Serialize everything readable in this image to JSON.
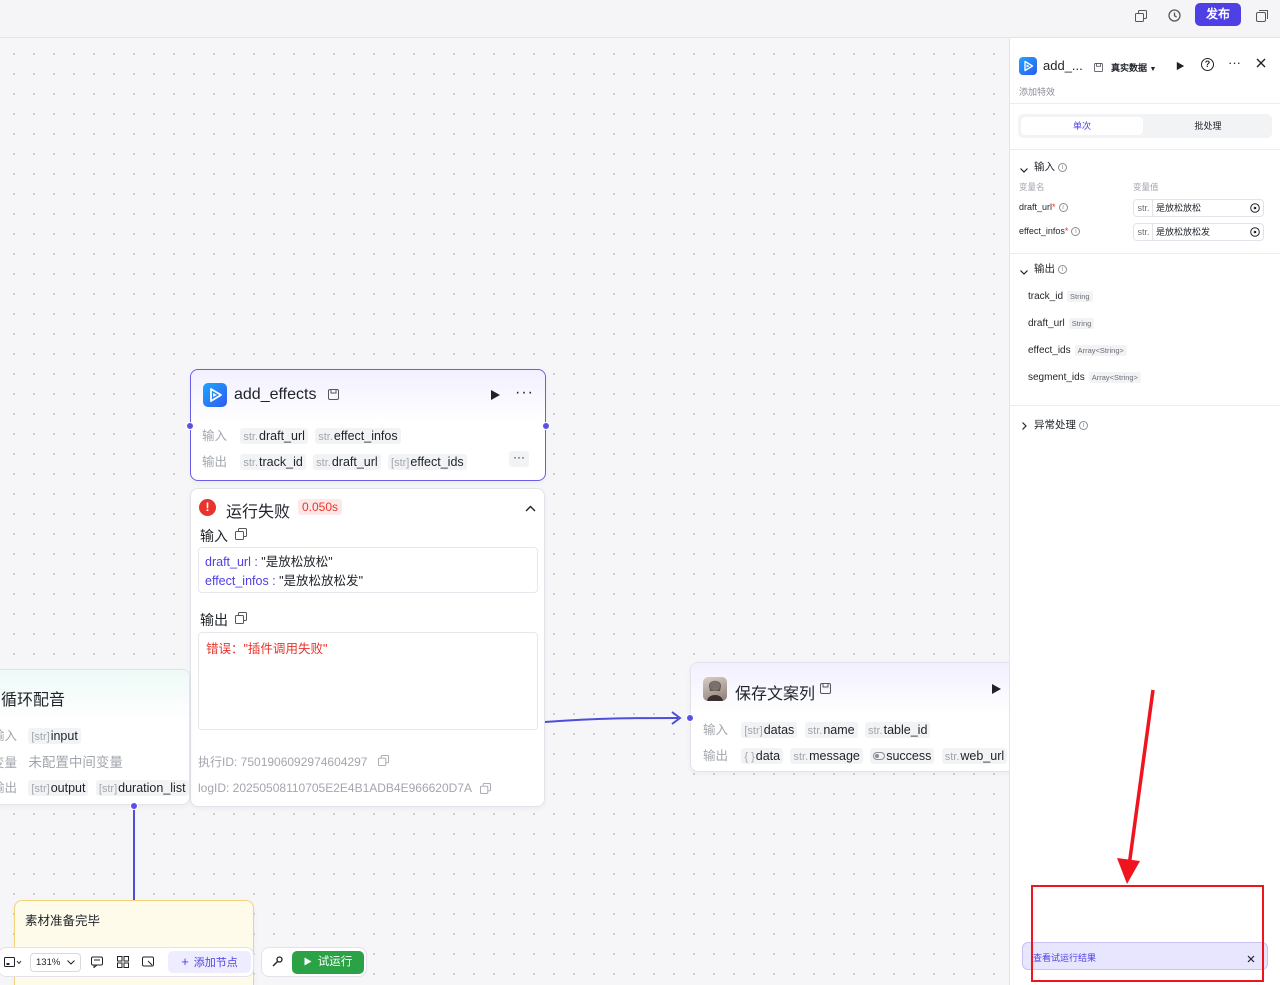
{
  "topbar": {
    "publish_label": "发布"
  },
  "node_effects": {
    "title": "add_effects",
    "input_label": "输入",
    "output_label": "输出",
    "inputs": [
      {
        "type": "str.",
        "name": "draft_url"
      },
      {
        "type": "str.",
        "name": "effect_infos"
      }
    ],
    "outputs": [
      {
        "type": "str.",
        "name": "track_id"
      },
      {
        "type": "str.",
        "name": "draft_url"
      },
      {
        "type": "[str]",
        "name": "effect_ids"
      }
    ]
  },
  "run_result": {
    "status": "运行失败",
    "duration": "0.050s",
    "input_title": "输入",
    "input_values": [
      {
        "key": "draft_url",
        "value": "\"是放松放松\""
      },
      {
        "key": "effect_infos",
        "value": "\"是放松放松发\""
      }
    ],
    "output_title": "输出",
    "error_text": "错误：\"插件调用失败\"",
    "exec_id": "执行ID: 7501906092974604297",
    "log_id": "logID: 20250508110705E2E4B1ADB4E966620D7A"
  },
  "node_loop": {
    "title": "循环配音",
    "row1_label": "输入",
    "row1_chip": {
      "type": "[str]",
      "name": "input"
    },
    "row2_label": "变量",
    "row2_text": "未配置中间变量",
    "row3_label": "输出",
    "row3_chips": [
      {
        "type": "[str]",
        "name": "output"
      },
      {
        "type": "[str]",
        "name": "duration_list"
      }
    ]
  },
  "node_save": {
    "title": "保存文案列",
    "input_label": "输入",
    "output_label": "输出",
    "inputs": [
      {
        "type": "[str]",
        "name": "datas"
      },
      {
        "type": "str.",
        "name": "name"
      },
      {
        "type": "str.",
        "name": "table_id"
      }
    ],
    "outputs": [
      {
        "type": "{ }",
        "name": "data"
      },
      {
        "type": "str.",
        "name": "message"
      },
      {
        "type": "",
        "name": "success"
      },
      {
        "type": "str.",
        "name": "web_url"
      }
    ]
  },
  "node_material": {
    "title": "素材准备完毕"
  },
  "bottom_toolbar": {
    "zoom": "131%",
    "add_node_label": "添加节点",
    "test_run_label": "试运行"
  },
  "panel": {
    "title": "add_...",
    "data_mode": "真实数据",
    "subtitle": "添加特效",
    "tabs": [
      "单次",
      "批处理"
    ],
    "input_section": "输入",
    "col_var_name": "变量名",
    "col_var_value": "变量值",
    "input_rows": [
      {
        "name": "draft_url",
        "type": "str.",
        "value": "是放松放松"
      },
      {
        "name": "effect_infos",
        "type": "str.",
        "value": "是放松放松发"
      }
    ],
    "output_section": "输出",
    "output_rows": [
      {
        "name": "track_id",
        "type": "String"
      },
      {
        "name": "draft_url",
        "type": "String"
      },
      {
        "name": "effect_ids",
        "type": "Array<String>"
      },
      {
        "name": "segment_ids",
        "type": "Array<String>"
      }
    ],
    "exception_section": "异常处理",
    "view_result_label": "查看试运行结果"
  },
  "colors": {
    "accent": "#4e40e5",
    "error": "#e8342c",
    "run_green": "#2ba245",
    "annotation_red": "#f0141e"
  }
}
